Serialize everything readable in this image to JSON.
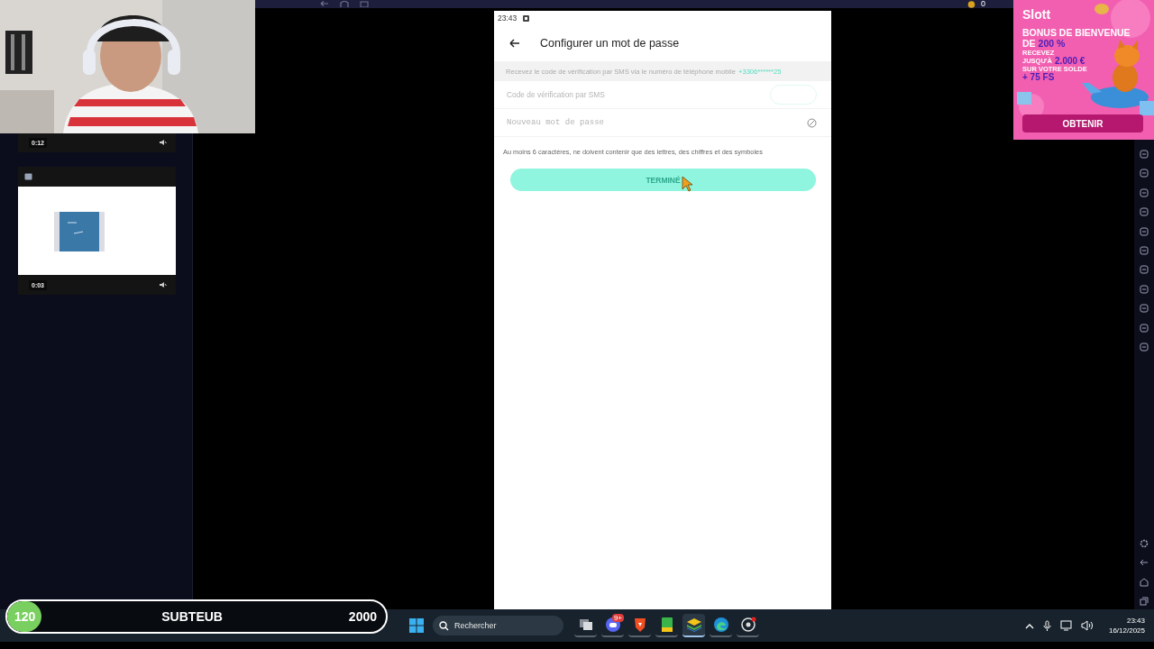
{
  "left_panel": {
    "cards": [
      {
        "kind": "footer",
        "time": "0:12"
      },
      {
        "kind": "full",
        "time": "0:03"
      }
    ]
  },
  "emulator": {
    "coins": "0"
  },
  "phone": {
    "status_time": "23:43",
    "title": "Configurer un mot de passe",
    "sms_notice": "Recevez le code de vérification par SMS via le numéro de téléphone mobile",
    "phone_number": "+3306******25",
    "code_field": {
      "placeholder": "Code de vérification par SMS"
    },
    "password_field": {
      "placeholder": "Nouveau mot de passe"
    },
    "hint": "Au moins 6 caractères, ne doivent contenir que des lettres, des chiffres et des symboles",
    "submit_button": {
      "label": "TERMINÉ",
      "disabled": true
    }
  },
  "ad": {
    "brand": "Slott",
    "lines": [
      {
        "kind": "big",
        "parts": [
          {
            "text": "BONUS DE BIENVENUE",
            "accent": false
          }
        ]
      },
      {
        "kind": "big",
        "parts": [
          {
            "text": "DE",
            "accent": false
          },
          {
            "text": "200 %",
            "accent": true
          }
        ]
      },
      {
        "kind": "small",
        "parts": [
          {
            "text": "RECEVEZ",
            "accent": false
          }
        ]
      },
      {
        "kind": "small",
        "parts": [
          {
            "text": "JUSQU'À",
            "accent": false
          },
          {
            "text": "2.000 €",
            "accent": true
          }
        ]
      },
      {
        "kind": "small",
        "parts": [
          {
            "text": "SUR VOTRE SOLDE",
            "accent": false
          }
        ]
      },
      {
        "kind": "small",
        "parts": [
          {
            "text": "+ 75 FS",
            "accent": true
          }
        ]
      }
    ],
    "button": "OBTENIR"
  },
  "sub_goal": {
    "current": "120",
    "label": "SUBTEUB",
    "target": "2000",
    "level": 0.09
  },
  "taskbar": {
    "search": {
      "placeholder": "Rechercher"
    },
    "apps": [
      {
        "kind": "taskview",
        "selected": false
      },
      {
        "kind": "chat",
        "badge": "9+",
        "selected": false
      },
      {
        "kind": "shield",
        "selected": false
      },
      {
        "kind": "notebook",
        "selected": false
      },
      {
        "kind": "layers",
        "selected": true
      },
      {
        "kind": "browser",
        "selected": false
      },
      {
        "kind": "aperture",
        "selected": false
      }
    ],
    "clock": {
      "time": "23:43",
      "date": "16/12/2025"
    }
  }
}
